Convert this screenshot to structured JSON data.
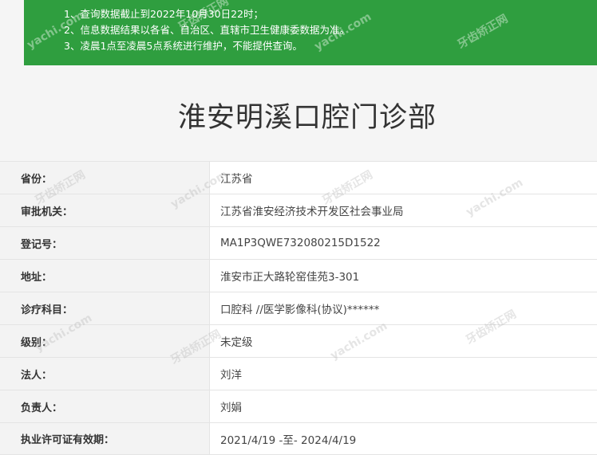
{
  "notice": {
    "lines": [
      "1、查询数据截止到2022年10月30日22时；",
      "2、信息数据结果以各省、自治区、直辖市卫生健康委数据为准。",
      "3、凌晨1点至凌晨5点系统进行维护，不能提供查询。"
    ]
  },
  "page_title": "淮安明溪口腔门诊部",
  "details": [
    {
      "label": "省份：",
      "value": "江苏省"
    },
    {
      "label": "审批机关：",
      "value": "江苏省淮安经济技术开发区社会事业局"
    },
    {
      "label": "登记号：",
      "value": "MA1P3QWE732080215D1522"
    },
    {
      "label": "地址：",
      "value": "淮安市正大路轮窑佳苑3-301"
    },
    {
      "label": "诊疗科目：",
      "value": "口腔科 //医学影像科(协议)******"
    },
    {
      "label": "级别：",
      "value": "未定级"
    },
    {
      "label": "法人：",
      "value": "刘洋"
    },
    {
      "label": "负责人：",
      "value": "刘娟"
    },
    {
      "label": "执业许可证有效期：",
      "value": "2021/4/19 -至- 2024/4/19"
    }
  ],
  "watermark_text": "牙齿矫正网",
  "watermark_latin": "yachi.com",
  "colors": {
    "notice_bg": "#2f9e3f",
    "label_bg": "#f3f3f3",
    "value_bg": "#ffffff"
  }
}
